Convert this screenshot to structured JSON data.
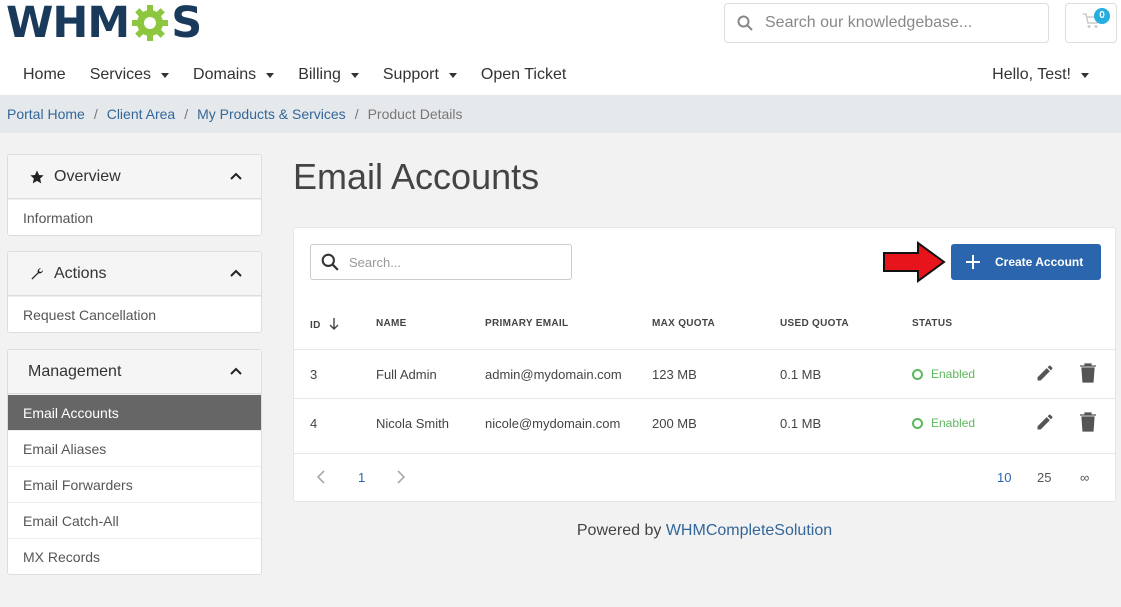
{
  "header": {
    "logo_prefix": "WHM",
    "logo_suffix": "S",
    "search_placeholder": "Search our knowledgebase...",
    "cart_count": "0"
  },
  "nav": {
    "items": [
      {
        "label": "Home",
        "dropdown": false
      },
      {
        "label": "Services",
        "dropdown": true
      },
      {
        "label": "Domains",
        "dropdown": true
      },
      {
        "label": "Billing",
        "dropdown": true
      },
      {
        "label": "Support",
        "dropdown": true
      },
      {
        "label": "Open Ticket",
        "dropdown": false
      }
    ],
    "user": "Hello, Test!"
  },
  "breadcrumb": {
    "items": [
      "Portal Home",
      "Client Area",
      "My Products & Services"
    ],
    "active": "Product Details"
  },
  "sidebar": {
    "overview": {
      "title": "Overview",
      "items": [
        "Information"
      ]
    },
    "actions": {
      "title": "Actions",
      "items": [
        "Request Cancellation"
      ]
    },
    "management": {
      "title": "Management",
      "items": [
        "Email Accounts",
        "Email Aliases",
        "Email Forwarders",
        "Email Catch-All",
        "MX Records"
      ],
      "active": "Email Accounts"
    }
  },
  "main": {
    "title": "Email Accounts",
    "search_placeholder": "Search...",
    "create_label": "Create Account",
    "columns": [
      "ID",
      "NAME",
      "PRIMARY EMAIL",
      "MAX QUOTA",
      "USED QUOTA",
      "STATUS"
    ],
    "rows": [
      {
        "id": "3",
        "name": "Full Admin",
        "email": "admin@mydomain.com",
        "max": "123 MB",
        "used": "0.1 MB",
        "status": "Enabled"
      },
      {
        "id": "4",
        "name": "Nicola Smith",
        "email": "nicole@mydomain.com",
        "max": "200 MB",
        "used": "0.1 MB",
        "status": "Enabled"
      }
    ],
    "pagination": {
      "current": "1",
      "per_page": [
        "10",
        "25",
        "∞"
      ],
      "per_page_selected": "10"
    }
  },
  "footer": {
    "prefix": "Powered by",
    "link": "WHMCompleteSolution"
  },
  "colors": {
    "primary": "#2b65ae",
    "success": "#5cb85c",
    "active_nav": "#666666",
    "gear_green": "#8dc63f",
    "logo_navy": "#1a3a5c"
  }
}
